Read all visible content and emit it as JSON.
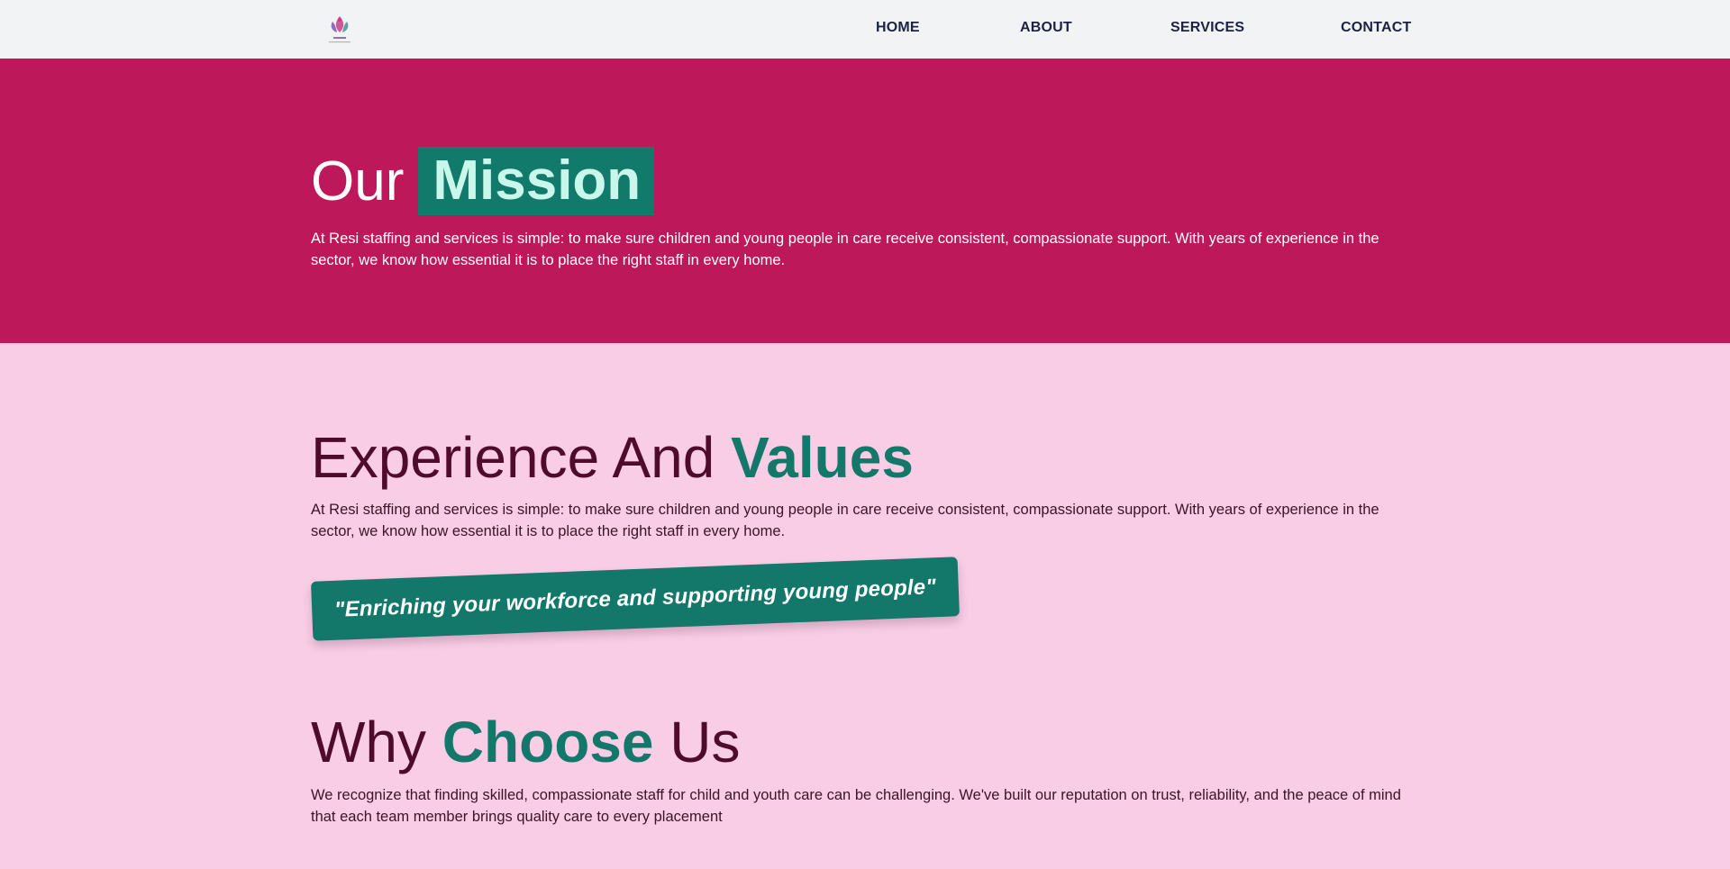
{
  "header": {
    "logo_icon": "resi-logo-icon",
    "nav": {
      "home": "HOME",
      "about": "ABOUT",
      "services": "SERVICES",
      "contact": "CONTACT"
    }
  },
  "mission": {
    "title_prefix": "Our",
    "title_highlight": "Mission",
    "text": "At Resi staffing and services is simple: to make sure children and young people in care receive consistent, compassionate support. With years of experience in the sector, we know how essential it is to place the right staff in every home."
  },
  "experience": {
    "title_prefix": "Experience And ",
    "title_accent": "Values",
    "text": "At Resi staffing and services is simple: to make sure children and young people in care receive consistent, compassionate support. With years of experience in the sector, we know how essential it is to place the right staff in every home.",
    "quote": "\"Enriching your workforce and supporting young people\""
  },
  "why": {
    "title_prefix": "Why ",
    "title_accent": "Choose",
    "title_suffix": " Us",
    "text": "We recognize that finding skilled, compassionate staff for child and youth care can be challenging. We've built our reputation on trust, reliability, and the peace of mind that each team member brings quality care to every placement"
  },
  "colors": {
    "header_bg": "#f2f3f5",
    "mission_bg": "#bd185a",
    "page_bg": "#f9cde6",
    "accent_green": "#13776a",
    "heading_dark": "#4f0b2c",
    "nav_text": "#1b2341"
  }
}
